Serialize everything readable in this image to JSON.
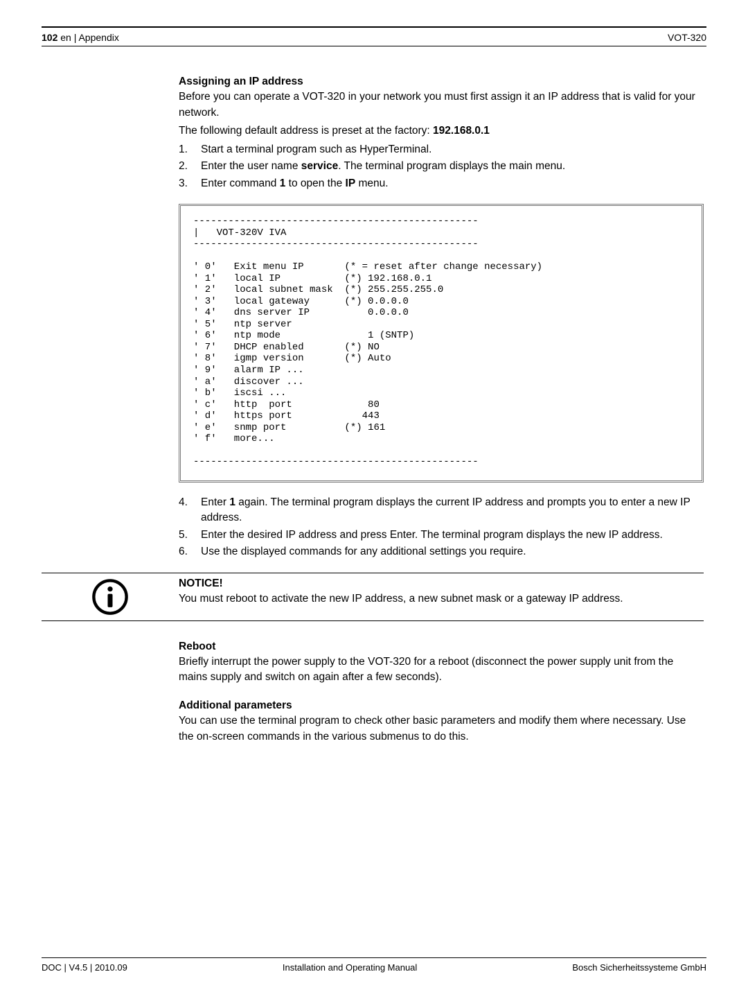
{
  "header": {
    "page_number": "102",
    "lang_section": "en | Appendix",
    "model": "VOT-320"
  },
  "s1": {
    "heading": "Assigning an IP address",
    "p1a": "Before you can operate a VOT-320 in your network you must first assign it an IP address that is valid for your network.",
    "p2a": "The following default address is preset at the factory: ",
    "p2b": "192.168.0.1",
    "step1": "Start a terminal program such as HyperTerminal.",
    "step2a": "Enter the user name ",
    "step2b": "service",
    "step2c": ". The terminal program displays the main menu.",
    "step3a": "Enter command ",
    "step3b": "1",
    "step3c": " to open the ",
    "step3d": "IP",
    "step3e": " menu."
  },
  "terminal": "-------------------------------------------------\n|   VOT-320V IVA\n-------------------------------------------------\n\n' 0'   Exit menu IP       (* = reset after change necessary)\n' 1'   local IP           (*) 192.168.0.1\n' 2'   local subnet mask  (*) 255.255.255.0\n' 3'   local gateway      (*) 0.0.0.0\n' 4'   dns server IP          0.0.0.0\n' 5'   ntp server\n' 6'   ntp mode               1 (SNTP)\n' 7'   DHCP enabled       (*) NO\n' 8'   igmp version       (*) Auto\n' 9'   alarm IP ...\n' a'   discover ...\n' b'   iscsi ...\n' c'   http  port             80\n' d'   https port            443\n' e'   snmp port          (*) 161\n' f'   more...\n\n-------------------------------------------------",
  "s2": {
    "step4a": "Enter ",
    "step4b": "1",
    "step4c": " again. The terminal program displays the current IP address and prompts you to enter a new IP address.",
    "step5": "Enter the desired IP address and press Enter. The terminal program displays the new IP address.",
    "step6": "Use the displayed commands for any additional settings you require."
  },
  "notice": {
    "title": "NOTICE!",
    "text": "You must reboot to activate the new IP address, a new subnet mask or a gateway IP address."
  },
  "reboot": {
    "heading": "Reboot",
    "text": "Briefly interrupt the power supply to the VOT-320 for a reboot (disconnect the power supply unit from the mains supply and switch on again after a few seconds)."
  },
  "addl": {
    "heading": "Additional parameters",
    "text": "You can use the terminal program to check other basic parameters and modify them where necessary. Use the on-screen commands in the various submenus to do this."
  },
  "footer": {
    "left": "DOC | V4.5 | 2010.09",
    "center": "Installation and Operating Manual",
    "right": "Bosch Sicherheitssysteme GmbH"
  },
  "nums": {
    "n1": "1.",
    "n2": "2.",
    "n3": "3.",
    "n4": "4.",
    "n5": "5.",
    "n6": "6."
  }
}
